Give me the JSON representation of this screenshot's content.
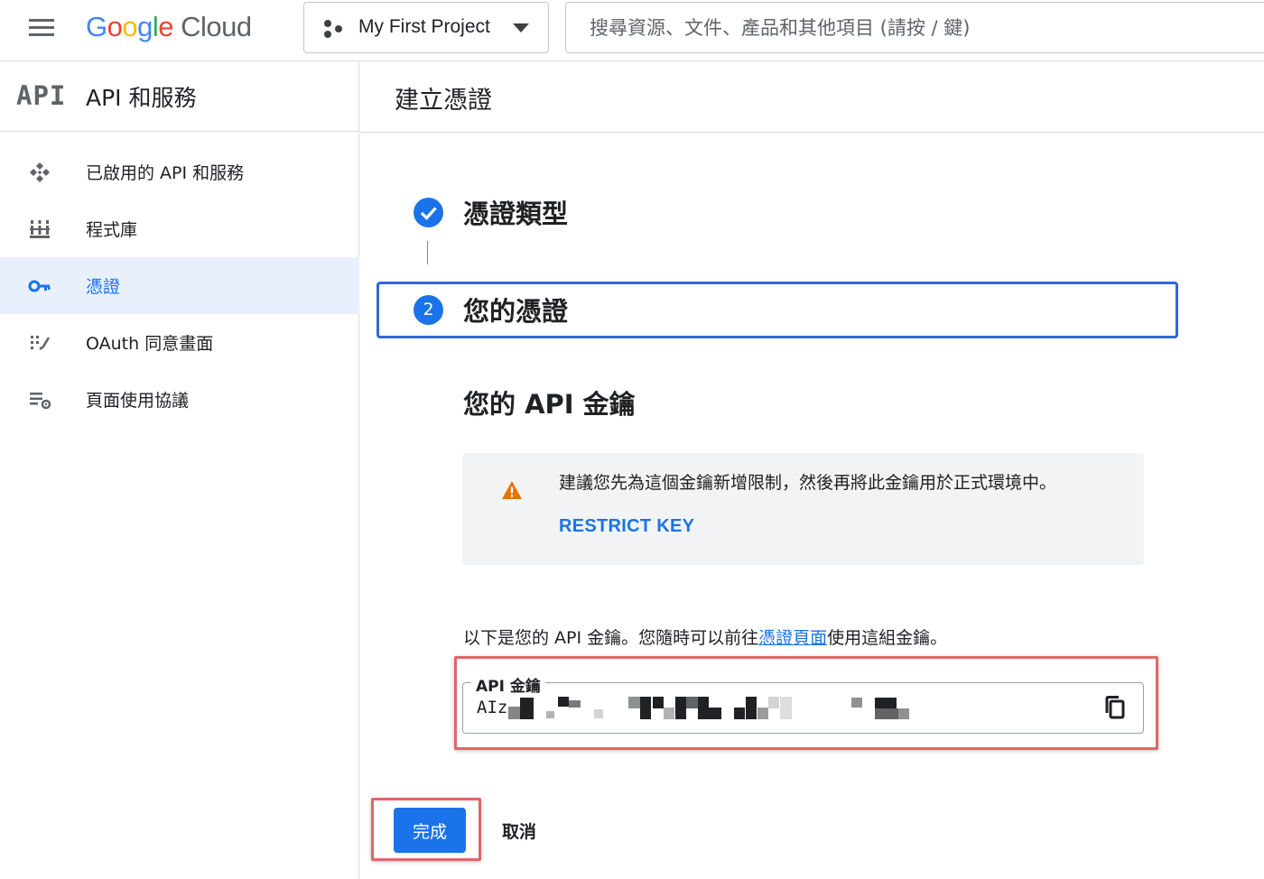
{
  "header": {
    "logo_google": "Google",
    "logo_cloud": "Cloud",
    "project_name": "My First Project",
    "search_placeholder": "搜尋資源、文件、產品和其他項目 (請按 / 鍵)"
  },
  "sidebar": {
    "logo": "API",
    "title": "API 和服務",
    "items": [
      {
        "label": "已啟用的 API 和服務",
        "icon": "apis-icon",
        "active": false
      },
      {
        "label": "程式庫",
        "icon": "library-icon",
        "active": false
      },
      {
        "label": "憑證",
        "icon": "key-icon",
        "active": true
      },
      {
        "label": "OAuth 同意畫面",
        "icon": "oauth-consent-icon",
        "active": false
      },
      {
        "label": "頁面使用協議",
        "icon": "page-usage-agreement-icon",
        "active": false
      }
    ]
  },
  "main": {
    "title": "建立憑證",
    "steps": [
      {
        "label": "憑證類型",
        "state": "complete"
      },
      {
        "number": "2",
        "label": "您的憑證",
        "state": "current"
      }
    ],
    "section_title": "您的 API 金鑰",
    "warning": {
      "icon": "warning-icon",
      "text": "建議您先為這個金鑰新增限制，然後再將此金鑰用於正式環境中。",
      "action_label": "RESTRICT KEY"
    },
    "info_prefix": "以下是您的 API 金鑰。您隨時可以前往",
    "info_link": "憑證頁面",
    "info_suffix": "使用這組金鑰。",
    "key_field": {
      "label": "API 金鑰",
      "visible_value": "AIz"
    },
    "done_label": "完成",
    "cancel_label": "取消"
  },
  "colors": {
    "accent": "#1a73e8",
    "active_nav_bg": "#e8f0fe",
    "warning": "#e37400",
    "annotation_highlight": "#e06666"
  }
}
